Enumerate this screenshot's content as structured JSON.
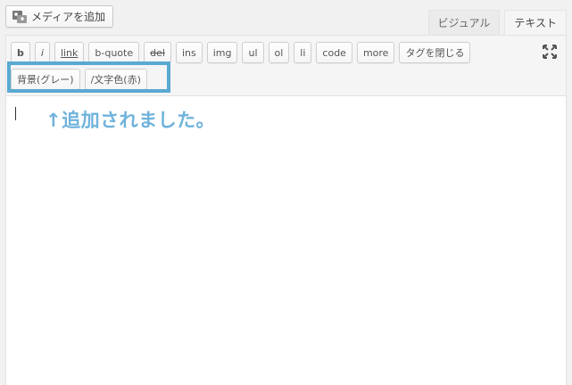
{
  "media_button": {
    "label": "メディアを追加",
    "icon": "media-add-icon"
  },
  "tabs": [
    {
      "label": "ビジュアル",
      "active": false
    },
    {
      "label": "テキスト",
      "active": true
    }
  ],
  "quicktags_row1": [
    "b",
    "i",
    "link",
    "b-quote",
    "del",
    "ins",
    "img",
    "ul",
    "ol",
    "li",
    "code",
    "more",
    "タグを閉じる"
  ],
  "quicktags_row2": [
    "背景(グレー)",
    "/文字色(赤)"
  ],
  "fullscreen_icon": "fullscreen-icon",
  "annotation": {
    "text": "↑追加されました。",
    "color": "#6fb3db"
  },
  "highlight_color": "#5aa9d2"
}
